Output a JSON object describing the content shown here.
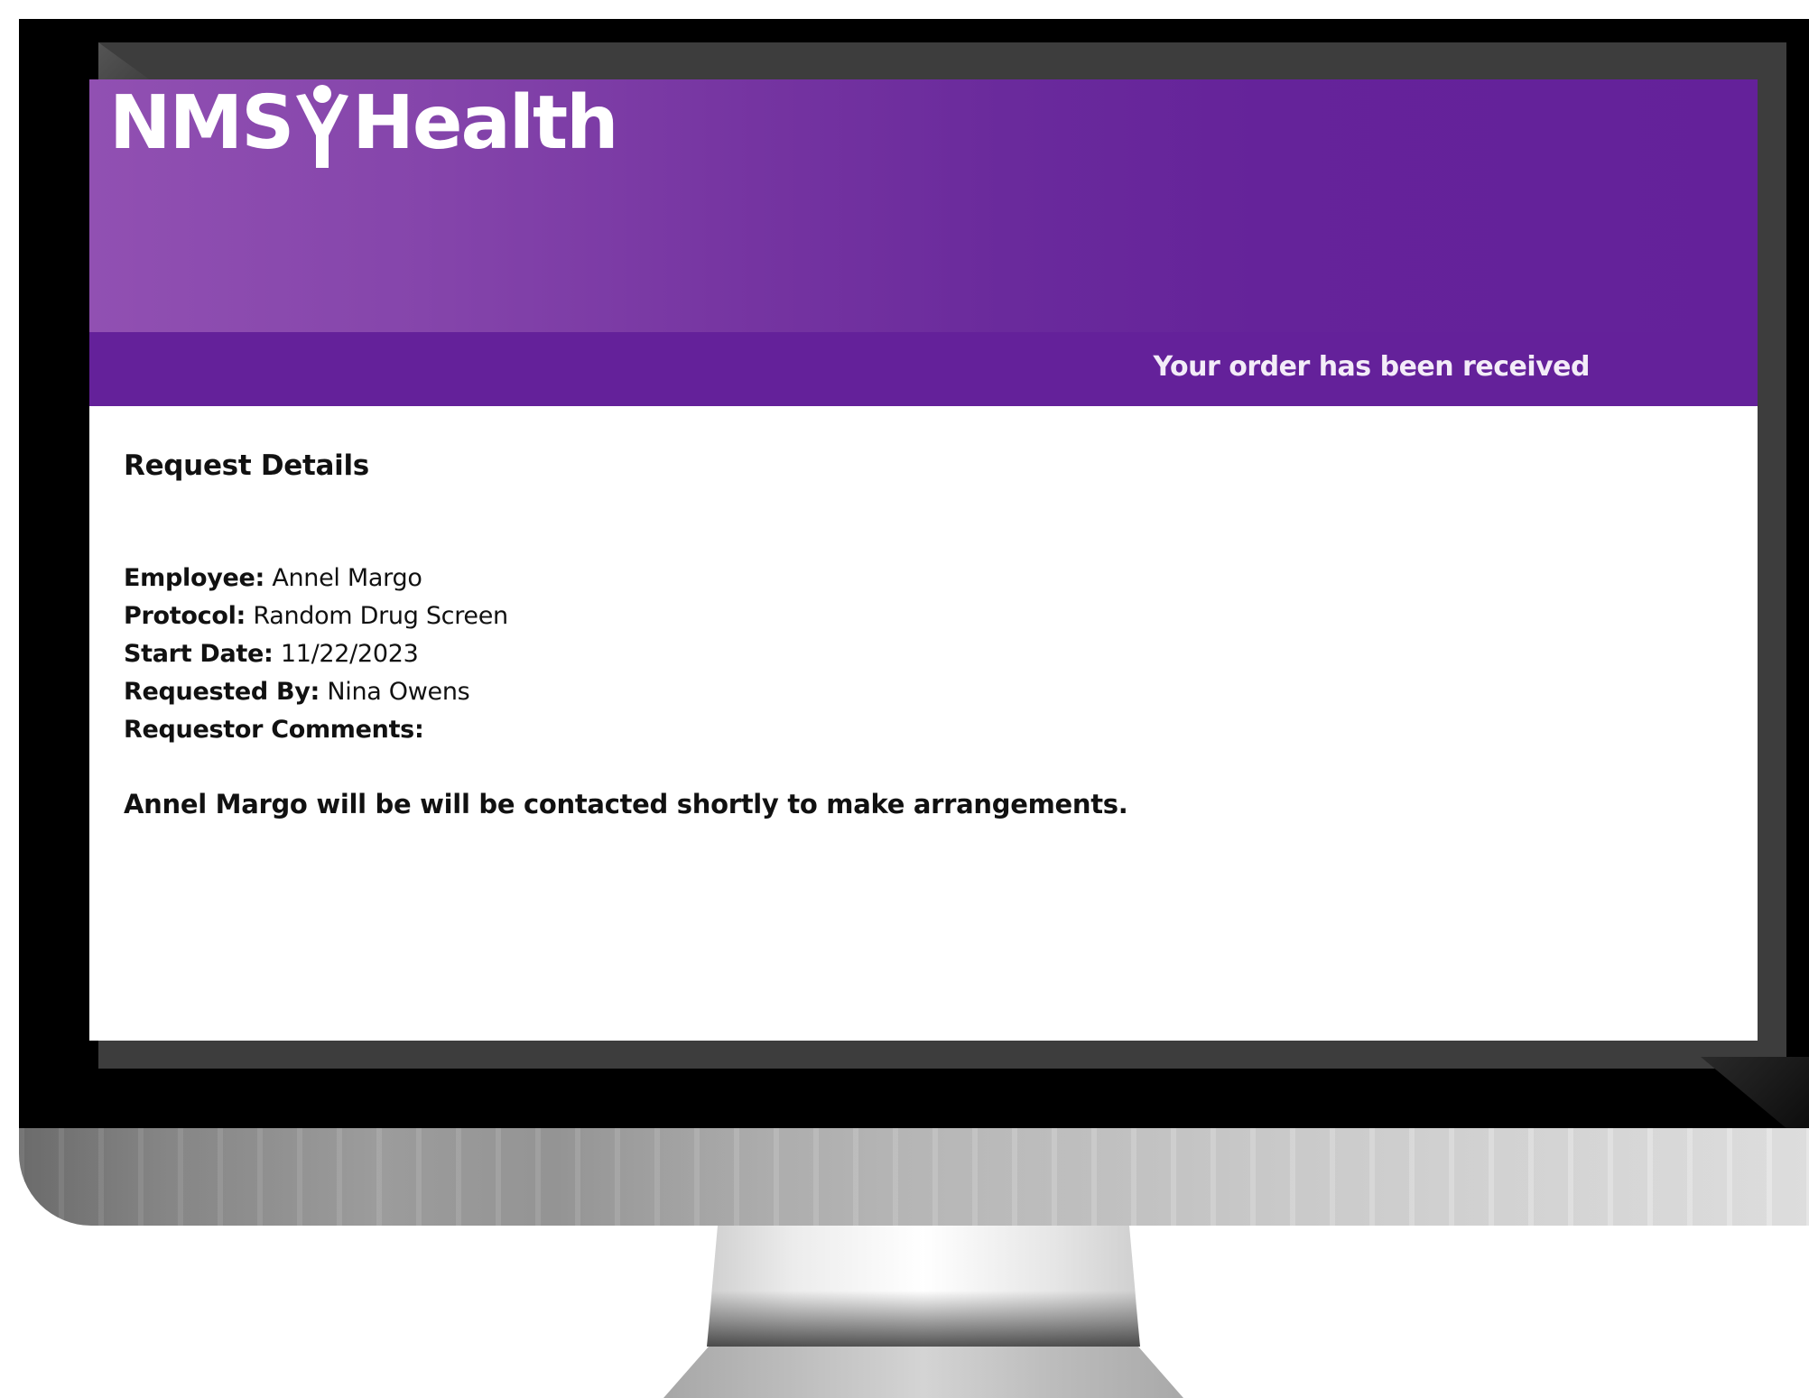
{
  "header": {
    "logo_text_left": "NMS",
    "logo_text_right": "Health",
    "logo_icon": "person-figure-icon",
    "banner_message": "Your order has been received"
  },
  "request": {
    "title": "Request Details",
    "fields": [
      {
        "label": "Employee:",
        "value": "Annel Margo"
      },
      {
        "label": "Protocol:",
        "value": "Random Drug Screen"
      },
      {
        "label": "Start Date:",
        "value": "11/22/2023"
      },
      {
        "label": "Requested By:",
        "value": "Nina Owens"
      },
      {
        "label": "Requestor Comments:",
        "value": ""
      }
    ],
    "closing_message": "Annel Margo will be will be contacted shortly to make arrangements."
  },
  "colors": {
    "brand_purple": "#64219a",
    "brand_purple_light": "#9150b2",
    "text": "#111111"
  }
}
